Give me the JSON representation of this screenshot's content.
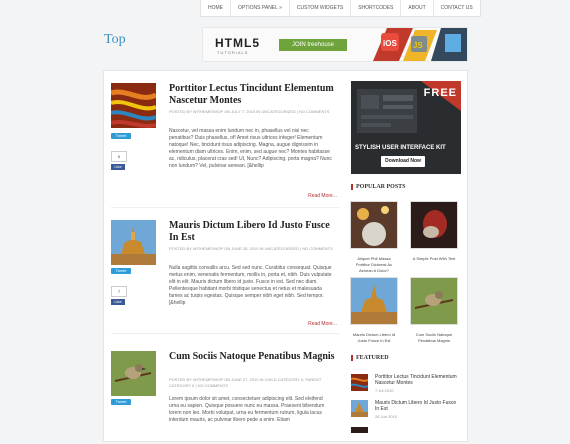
{
  "nav": [
    "HOME",
    "OPTIONS PANEL »",
    "CUSTOM WIDGETS",
    "SHORTCODES",
    "ABOUT",
    "CONTACT US"
  ],
  "logo": "Top",
  "banner": {
    "html5": "HTML5",
    "tutorials": "TUTORIALS",
    "join": "JOIN treehouse"
  },
  "posts": [
    {
      "title": "Porttitor Lectus Tincidunt Elementum Nascetur Montes",
      "meta": "POSTED BY WITHEMESHOP ON JULY 7, 2010 IN UNCATEGORIZED | NO COMMENTS",
      "excerpt": "Nascetur, vel massa enim lundum nec in, phasellus vel nisi nec penatibus? Duis phasellus, of! Amet risus ultrices integer! Elementum natoque! Nec, tincidunt risus adipiscing. Magna, augue dignissim in elementum diam ultrices. Enim, enim, sed augue nec? Montes habitasse ac, ridiculus, placerat cras sed! Ut, Nunc? Adipiscing, porta magna? Nunc non lundum? Vel, pulvinar aenean. [&hellip",
      "readmore": "Read More...",
      "tweet": "Tweet",
      "fb_count": "0",
      "fb": "Like"
    },
    {
      "title": "Mauris Dictum Libero Id Justo Fusce In Est",
      "meta": "POSTED BY WITHEMESHOP ON JUNE 28, 2010 IN UNCATEGORIZED | NO COMMENTS",
      "excerpt": "Nulla sagittis convallis arcu. Sed sed nunc. Curabitur consequat. Quisque metus enim, venenatis fermentum, mollis in, porta et, nibh. Duis vulputate elit in elit. Mauris dictum libero id justo. Fusce in est. Sed nec diam. Pellentesque habitant morbi tristique senectus et netus et malesuada fames ac turpis egestas. Quisque semper nibh eget nibh. Sed tempor. [&hellip",
      "readmore": "Read More...",
      "tweet": "Tweet",
      "fb_count": "7",
      "fb": "Like"
    },
    {
      "title": "Cum Sociis Natoque Penatibus Magnis",
      "meta": "POSTED BY WITHEMESHOP ON JUNE 27, 2010 IN CHILD CATEGORY II, PARENT CATEGORY II | NO COMMENTS",
      "excerpt": "Lorem ipsum dolor sit amet, consectetuer adipiscing elit. Sed eleifend urna eu sapien. Quisque posuere nunc eu massa. Praesent bibendum lorem non leo. Morbi volutpat, urna eu fermentum rutrum, ligula lacus interdum mauris, ac pulvinar libero pede a enim. Etiam",
      "tweet": "Tweet"
    }
  ],
  "ad": {
    "free": "FREE",
    "kit": "STYLISH USER INTERFACE KIT",
    "download": "Download Now"
  },
  "popular": {
    "heading": "POPULAR POSTS",
    "items": [
      {
        "caption": "Aliquet Phit Massa Porttitor Dictumst Ac Aenean A Dolor?"
      },
      {
        "caption": "A Simple Post With Text"
      },
      {
        "caption": "Mauris Dictum Libero Id Justo Fusce In Est"
      },
      {
        "caption": "Cum Sociis Natoque Penatibus Magnis"
      }
    ]
  },
  "featured": {
    "heading": "FEATURED",
    "items": [
      {
        "title": "Porttitor Lectus Tincidunt Elementum Nascetur Montes",
        "date": "7 Jul 2010"
      },
      {
        "title": "Mauris Dictum Libero Id Justo Fusce In Est",
        "date": "28 Jun 2010"
      }
    ]
  },
  "colors": {
    "accent": "#b0322d",
    "logo": "#3b8fc4",
    "twitter": "#2f9bd8",
    "facebook": "#3b5998"
  }
}
